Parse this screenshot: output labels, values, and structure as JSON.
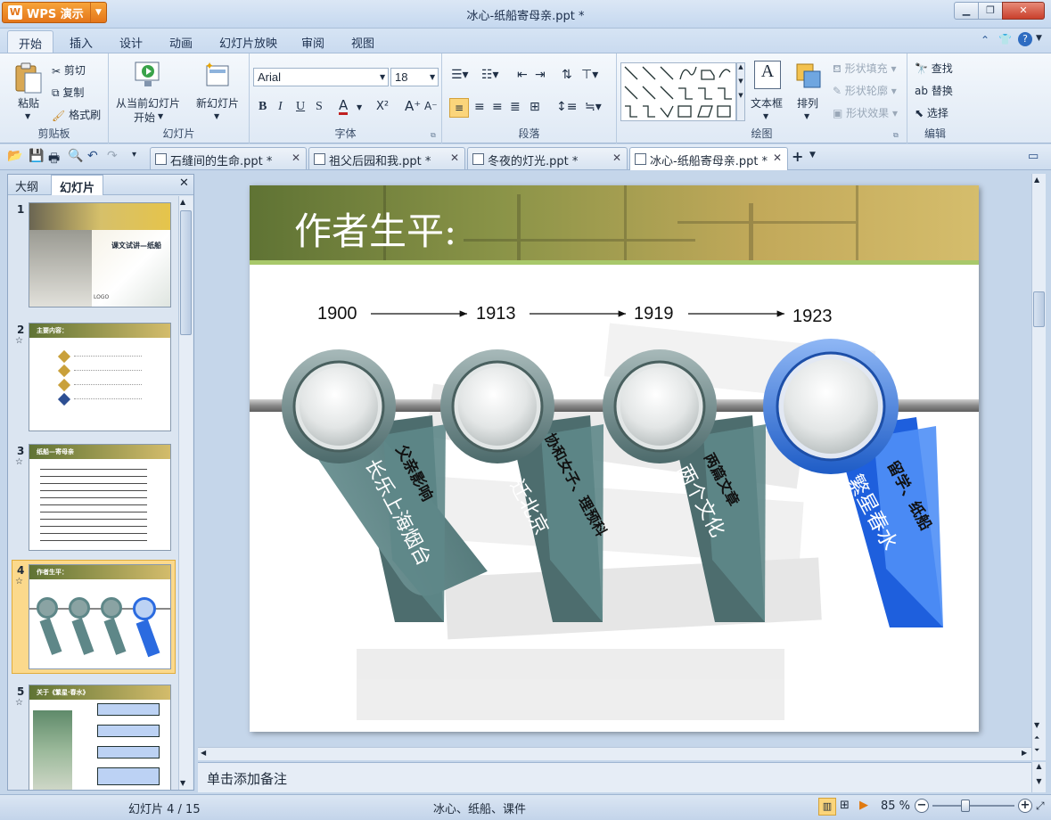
{
  "app": {
    "name": "WPS 演示",
    "window_title": "冰心-纸船寄母亲.ppt *"
  },
  "menu_tabs": [
    "开始",
    "插入",
    "设计",
    "动画",
    "幻灯片放映",
    "审阅",
    "视图"
  ],
  "ribbon": {
    "clipboard": {
      "paste": "粘贴",
      "cut": "剪切",
      "copy": "复制",
      "format_painter": "格式刷",
      "label": "剪贴板"
    },
    "slides": {
      "from_current": "从当前幻灯片",
      "start": "开始",
      "new_slide": "新幻灯片",
      "label": "幻灯片"
    },
    "font": {
      "name": "Arial",
      "size": "18",
      "label": "字体"
    },
    "paragraph": {
      "label": "段落"
    },
    "drawing": {
      "textbox": "文本框",
      "arrange": "排列",
      "shape_fill": "形状填充",
      "shape_outline": "形状轮廓",
      "shape_effect": "形状效果",
      "label": "绘图"
    },
    "editing": {
      "find": "查找",
      "replace": "替换",
      "select": "选择",
      "label": "编辑"
    }
  },
  "doc_tabs": [
    {
      "label": "石缝间的生命.ppt *"
    },
    {
      "label": "祖父后园和我.ppt *"
    },
    {
      "label": "冬夜的灯光.ppt *"
    },
    {
      "label": "冰心-纸船寄母亲.ppt *"
    }
  ],
  "left_panel": {
    "tab_outline": "大纲",
    "tab_slides": "幻灯片"
  },
  "thumbnails": [
    {
      "num": "1",
      "title": "课文试讲—纸船",
      "sub": "LOGO"
    },
    {
      "num": "2",
      "title": "主要内容："
    },
    {
      "num": "3",
      "title": "纸船—寄母亲"
    },
    {
      "num": "4",
      "title": "作者生平："
    },
    {
      "num": "5",
      "title": "关于《繁星·春水》"
    }
  ],
  "slide": {
    "title": "作者生平:",
    "years": [
      "1900",
      "1913",
      "1919",
      "1923"
    ],
    "tags": [
      {
        "top": "父亲影响",
        "main": "长乐上海烟台"
      },
      {
        "top": "协和女子、理预科",
        "main": "迁北京"
      },
      {
        "top": "两篇文章",
        "main": "两个文化"
      },
      {
        "top": "留学、纸船",
        "main": "繁星春水"
      }
    ]
  },
  "notes_placeholder": "单击添加备注",
  "status": {
    "slide_counter": "幻灯片 4 / 15",
    "keywords": "冰心、纸船、课件",
    "zoom": "85 %"
  },
  "colors": {
    "accent": "#2b6be0",
    "teal": "#5e8788",
    "header_olive": "#8b9448"
  }
}
